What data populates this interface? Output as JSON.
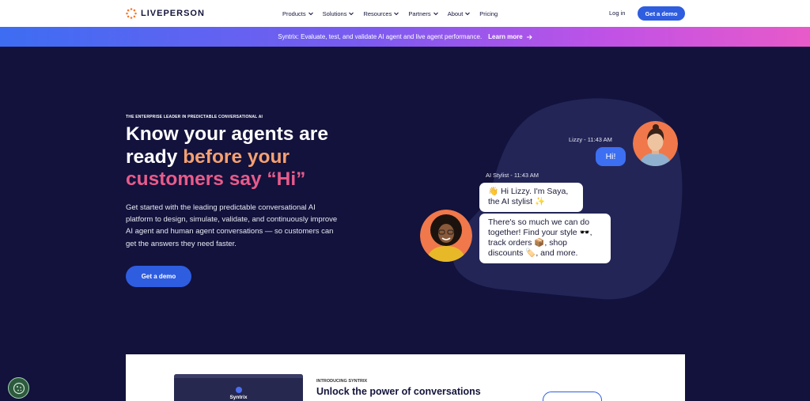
{
  "brand": {
    "name": "LIVEPERSON"
  },
  "nav": {
    "menu": [
      {
        "label": "Products",
        "has_dropdown": true
      },
      {
        "label": "Solutions",
        "has_dropdown": true
      },
      {
        "label": "Resources",
        "has_dropdown": true
      },
      {
        "label": "Partners",
        "has_dropdown": true
      },
      {
        "label": "About",
        "has_dropdown": true
      },
      {
        "label": "Pricing",
        "has_dropdown": false
      }
    ],
    "login_label": "Log in",
    "demo_label": "Get a demo"
  },
  "banner": {
    "text": "Syntrix: Evaluate, test, and validate AI agent and live agent performance.",
    "link_label": "Learn more"
  },
  "hero": {
    "eyebrow": "THE ENTERPRISE LEADER IN PREDICTABLE CONVERSATIONAL AI",
    "headline_part1": "Know your agents are ready ",
    "headline_part2": "before your",
    "headline_part3": "customers say “Hi”",
    "description": "Get started with the leading predictable conversational AI platform to design, simulate, validate, and continuously improve AI agent and human agent conversations — so customers can get the answers they need faster.",
    "cta_label": "Get a demo"
  },
  "chat": {
    "customer_meta": "Lizzy - 11:43 AM",
    "customer_message": "Hi!",
    "agent_meta": "AI Stylist - 11:43 AM",
    "agent_message_1": "👋 Hi Lizzy. I'm Saya, the AI stylist ✨",
    "agent_message_2": "There's so much we can do together! Find your style 🕶️, track orders 📦, shop discounts 🏷️, and more."
  },
  "feature_card": {
    "eyebrow": "INTRODUCING SYNTRIX",
    "title": "Unlock the power of conversations",
    "screenshot_title": "Syntrix"
  },
  "colors": {
    "page_bg": "#12123c",
    "brand_blue": "#2f5de0",
    "banner_start": "#3d6df2",
    "banner_end": "#e85ac9",
    "accent_orange": "#f6a071",
    "accent_pink": "#e95b8a",
    "blob": "#232557",
    "avatar_bg": "#f0784a"
  },
  "icons": [
    "liveperson-logo-icon",
    "chevron-down-icon",
    "arrow-right-icon",
    "cookie-icon"
  ]
}
